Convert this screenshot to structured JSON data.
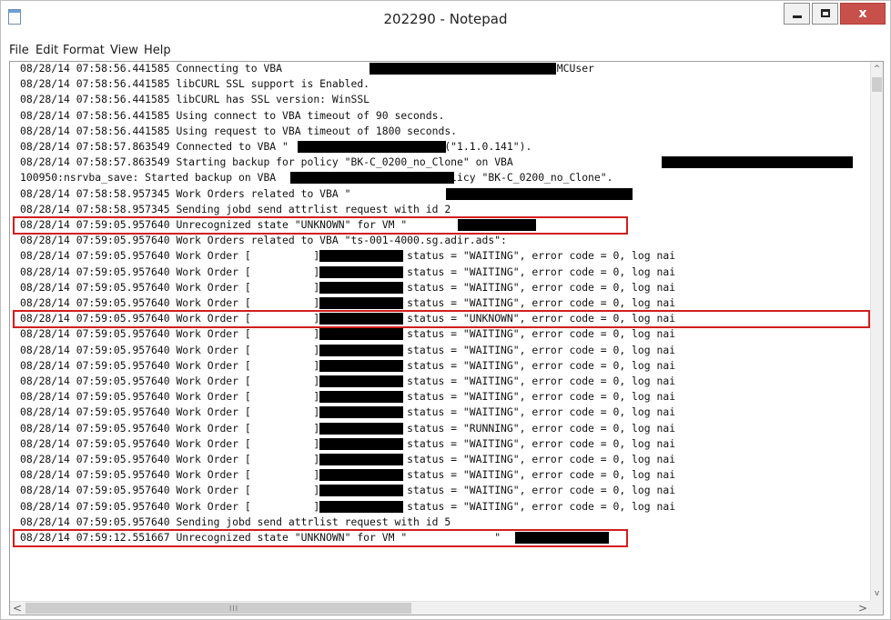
{
  "window": {
    "title": "202290 - Notepad",
    "close_glyph": "x",
    "icons": {
      "app": "notepad-icon",
      "minimize": "minimize-icon",
      "maximize": "maximize-icon",
      "close": "close-icon"
    }
  },
  "menu": [
    "File",
    "Edit",
    "Format",
    "View",
    "Help"
  ],
  "log_lines": [
    "08/28/14 07:58:56.441585 Connecting to VBA                          , port 8543, user MCUser",
    "08/28/14 07:58:56.441585 libCURL SSL support is Enabled.",
    "08/28/14 07:58:56.441585 libCURL has SSL version: WinSSL",
    "08/28/14 07:58:56.441585 Using connect to VBA timeout of 90 seconds.",
    "08/28/14 07:58:56.441585 Using request to VBA timeout of 1800 seconds.",
    "08/28/14 07:58:57.863549 Connected to VBA \"                       \" (\"1.1.0.141\").",
    "08/28/14 07:58:57.863549 Starting backup for policy \"BK-C_0200_no_Clone\" on VBA",
    "100950:nsrvba_save: Started backup on VBA                      for policy \"BK-C_0200_no_Clone\".",
    "08/28/14 07:58:58.957345 Work Orders related to VBA \"                       \":",
    "08/28/14 07:58:58.957345 Sending jobd send attrlist request with id 2",
    "08/28/14 07:59:05.957640 Unrecognized state \"UNKNOWN\" for VM \"             \"",
    "08/28/14 07:59:05.957640 Work Orders related to VBA \"ts-001-4000.sg.adir.ads\":",
    "08/28/14 07:59:05.957640 Work Order [          ]: job_id = 0, status = \"WAITING\", error code = 0, log nai",
    "08/28/14 07:59:05.957640 Work Order [          ]: job_id = 0, status = \"WAITING\", error code = 0, log nai",
    "08/28/14 07:59:05.957640 Work Order [          ]: job_id = 0, status = \"WAITING\", error code = 0, log nai",
    "08/28/14 07:59:05.957640 Work Order [          ]: job_id = 0, status = \"WAITING\", error code = 0, log nai",
    "08/28/14 07:59:05.957640 Work Order [          ]: job_id = 0, status = \"UNKNOWN\", error code = 0, log nai",
    "08/28/14 07:59:05.957640 Work Order [          ]: job_id = 0, status = \"WAITING\", error code = 0, log nai",
    "08/28/14 07:59:05.957640 Work Order [          ]: job_id = 0, status = \"WAITING\", error code = 0, log nai",
    "08/28/14 07:59:05.957640 Work Order [          ]: job_id = 0, status = \"WAITING\", error code = 0, log nai",
    "08/28/14 07:59:05.957640 Work Order [          ]: job_id = 0, status = \"WAITING\", error code = 0, log nai",
    "08/28/14 07:59:05.957640 Work Order [          ]: job_id = 0, status = \"WAITING\", error code = 0, log nai",
    "08/28/14 07:59:05.957640 Work Order [          ]: job_id = 0, status = \"WAITING\", error code = 0, log nai",
    "08/28/14 07:59:05.957640 Work Order [          ]: job_id = 0, status = \"RUNNING\", error code = 0, log nai",
    "08/28/14 07:59:05.957640 Work Order [          ]: job_id = 0, status = \"WAITING\", error code = 0, log nai",
    "08/28/14 07:59:05.957640 Work Order [          ]: job_id = 0, status = \"WAITING\", error code = 0, log nai",
    "08/28/14 07:59:05.957640 Work Order [          ]: job_id = 0, status = \"WAITING\", error code = 0, log nai",
    "08/28/14 07:59:05.957640 Work Order [          ]: job_id = 0, status = \"WAITING\", error code = 0, log nai",
    "08/28/14 07:59:05.957640 Work Order [          ]: job_id = 0, status = \"WAITING\", error code = 0, log nai",
    "08/28/14 07:59:05.957640 Sending jobd send attrlist request with id 5",
    "08/28/14 07:59:12.551667 Unrecognized state \"UNKNOWN\" for VM \"              \""
  ],
  "highlight_color": "#d21e1e",
  "redaction_color": "#000000",
  "scrollbars": {
    "up_glyph": "^",
    "down_glyph": "v",
    "left_glyph": "<",
    "right_glyph": ">",
    "grip_glyph": "III",
    "icons": {
      "up": "scroll-up-icon",
      "down": "scroll-down-icon",
      "left": "scroll-left-icon",
      "right": "scroll-right-icon"
    }
  }
}
